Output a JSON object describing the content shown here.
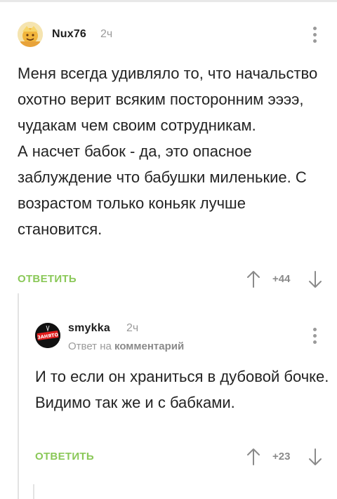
{
  "comments": [
    {
      "username": "Nux76",
      "time": "2ч",
      "paragraphs": [
        "Меня всегда удивляло то, что начальство охотно верит всяким посторонним ээээ, чудакам чем своим сотрудникам.",
        "А насчет бабок - да, это опасное заблуждение что бабушки миленькие. С возрастом только коньяк лучше становится."
      ],
      "reply_label": "ОТВЕТИТЬ",
      "rating": "+44",
      "avatar_icon": "smiling-sun-avatar-icon"
    },
    {
      "username": "smykka",
      "time": "2ч",
      "reply_to_prefix": "Ответ на",
      "reply_to_target": "комментарий",
      "avatar_text": "ЗАНЯТО",
      "paragraphs": [
        "И то если он храниться в дубовой бочке.",
        "Видимо так же и с бабками."
      ],
      "reply_label": "ОТВЕТИТЬ",
      "rating": "+23",
      "avatar_icon": "busy-sign-avatar-icon"
    }
  ],
  "colors": {
    "accent_green": "#8ac858",
    "muted_text": "#9a9a9a",
    "body_text": "#232323"
  }
}
